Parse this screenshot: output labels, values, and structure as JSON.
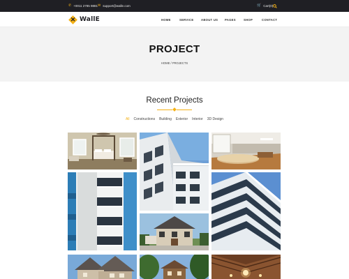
{
  "topbar": {
    "phone": "+0011 2785 9881",
    "email": "support@walle.com",
    "cart": "Cart(0)"
  },
  "brand": {
    "name": "WallE"
  },
  "nav": {
    "items": [
      "HOME",
      "SERVICE",
      "ABOUT US",
      "PAGES",
      "SHOP",
      "CONTACT"
    ]
  },
  "banner": {
    "title": "PROJECT",
    "breadcrumb": "HOME / PROJECTS"
  },
  "section": {
    "title": "Recent Projects"
  },
  "filters": [
    {
      "label": "All",
      "active": true
    },
    {
      "label": "Constructions",
      "active": false
    },
    {
      "label": "Building",
      "active": false
    },
    {
      "label": "Exterior",
      "active": false
    },
    {
      "label": "Interior",
      "active": false
    },
    {
      "label": "3D Design",
      "active": false
    }
  ],
  "colors": {
    "accent": "#f5b114",
    "topbar": "#1f1f24",
    "banner": "#f3f3f3"
  },
  "icons": [
    "phone-icon",
    "mail-icon",
    "cart-icon",
    "search-icon",
    "logo-icon"
  ],
  "gallery": [
    {
      "name": "project-bedroom-interior"
    },
    {
      "name": "project-white-building"
    },
    {
      "name": "project-office-interior"
    },
    {
      "name": "project-balcony-building"
    },
    {
      "name": "project-tower-sky"
    },
    {
      "name": "project-suburban-house"
    },
    {
      "name": "project-stone-house"
    },
    {
      "name": "project-green-house"
    },
    {
      "name": "project-wood-ceiling"
    }
  ]
}
